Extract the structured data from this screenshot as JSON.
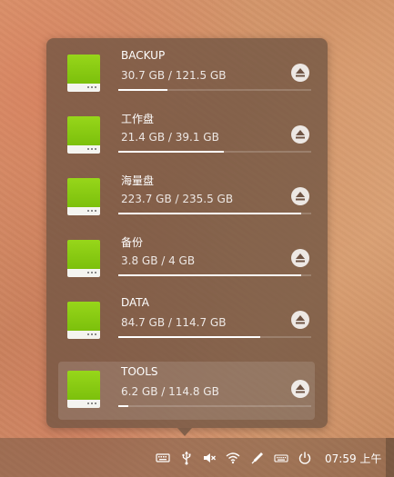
{
  "popup": {
    "disks": [
      {
        "name": "BACKUP",
        "size": "30.7 GB / 121.5 GB",
        "usage": 0.253,
        "active": false
      },
      {
        "name": "工作盘",
        "size": "21.4 GB / 39.1 GB",
        "usage": 0.547,
        "active": false
      },
      {
        "name": "海量盘",
        "size": "223.7 GB / 235.5 GB",
        "usage": 0.95,
        "active": false
      },
      {
        "name": "备份",
        "size": "3.8 GB / 4 GB",
        "usage": 0.95,
        "active": false
      },
      {
        "name": "DATA",
        "size": "84.7 GB / 114.7 GB",
        "usage": 0.738,
        "active": false
      },
      {
        "name": "TOOLS",
        "size": "6.2 GB / 114.8 GB",
        "usage": 0.054,
        "active": true
      }
    ]
  },
  "taskbar": {
    "tray_icons": [
      "keyboard-icon",
      "usb-icon",
      "volume-muted-icon",
      "wifi-icon",
      "pen-icon",
      "onscreen-keyboard-icon",
      "power-icon"
    ],
    "clock": "07:59 上午"
  },
  "colors": {
    "disk_icon_green": "#8ccd12",
    "popup_bg": "#705442",
    "usage_bar": "#ffffff"
  }
}
